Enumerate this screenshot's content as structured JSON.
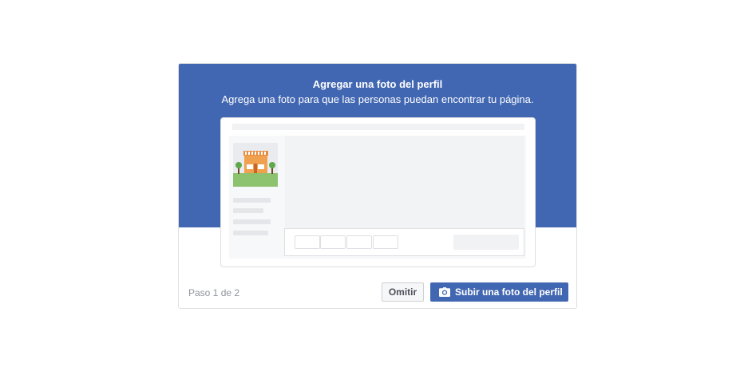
{
  "dialog": {
    "title": "Agregar una foto del perfil",
    "subtitle": "Agrega una foto para que las personas puedan encontrar tu página.",
    "step": "Paso 1 de 2",
    "skip_label": "Omitir",
    "upload_label": "Subir una foto del perfil",
    "upload_icon": "camera-icon"
  },
  "colors": {
    "brand": "#4267b2",
    "step_text": "#90949c"
  }
}
